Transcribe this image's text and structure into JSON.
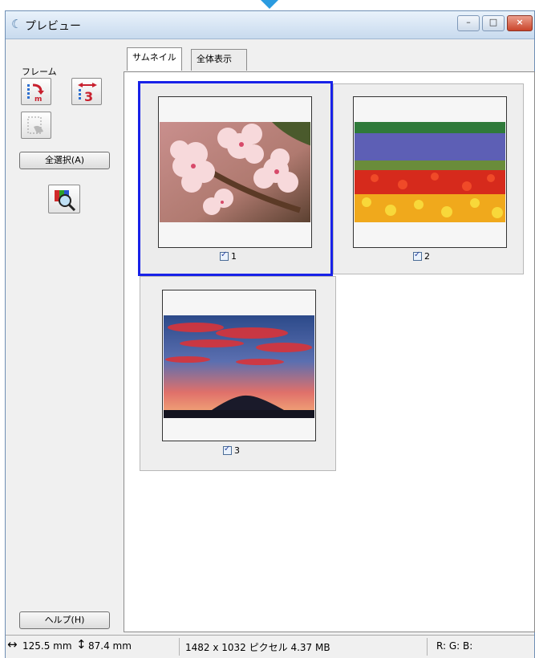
{
  "window": {
    "title": "プレビュー",
    "controls": {
      "minimize": "–",
      "maximize": "□",
      "close": "×"
    }
  },
  "left_panel": {
    "frame_label": "フレーム",
    "select_all_label": "全選択(A)",
    "help_label": "ヘルプ(H)"
  },
  "tabs": [
    {
      "label": "サムネイル",
      "active": true
    },
    {
      "label": "全体表示",
      "active": false
    }
  ],
  "thumbnails": [
    {
      "number": "1",
      "checked": true,
      "selected": true,
      "image": "cherry-blossoms-photo"
    },
    {
      "number": "2",
      "checked": true,
      "selected": false,
      "image": "flower-field-photo"
    },
    {
      "number": "3",
      "checked": true,
      "selected": false,
      "image": "sunset-mountain-photo"
    }
  ],
  "status": {
    "width_icon": "horizontal-arrow-icon",
    "width": "125.5 mm",
    "height_icon": "vertical-arrow-icon",
    "height": "87.4 mm",
    "pixels_size": "1482 x 1032 ピクセル 4.37 MB",
    "rgb": "R: G: B:"
  },
  "colors": {
    "selection_border": "#1822e8",
    "title_gradient_top": "#e9f2fb",
    "title_gradient_bottom": "#c8daee",
    "close_button": "#c9442a"
  }
}
